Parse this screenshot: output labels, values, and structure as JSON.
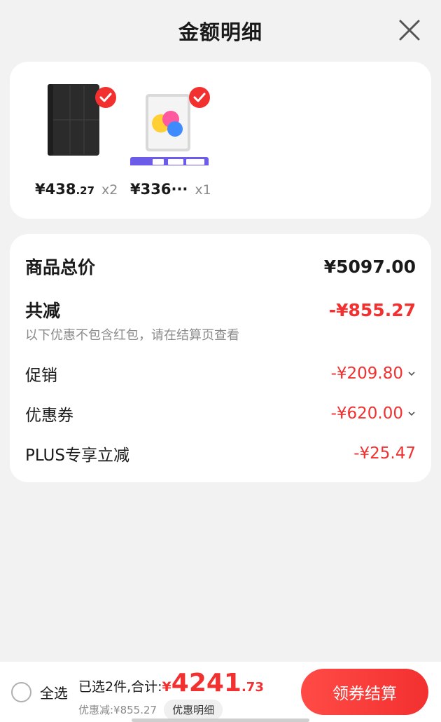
{
  "header": {
    "title": "金额明细",
    "close_icon": "close-icon"
  },
  "products": [
    {
      "price_yen": "¥",
      "price_int": "438",
      "price_dec": ".27",
      "qty": "x2",
      "image": "tablet-case-black",
      "checked": true
    },
    {
      "price_yen": "¥",
      "price_int": "336···",
      "price_dec": "",
      "qty": "x1",
      "image": "ipad-silver",
      "checked": true
    }
  ],
  "summary": {
    "total_label": "商品总价",
    "total_value": "¥5097.00",
    "reduced_label": "共减",
    "reduced_value": "-¥855.27",
    "note": "以下优惠不包含红包，请在结算页查看",
    "items": [
      {
        "label": "促销",
        "value": "-¥209.80",
        "expandable": true
      },
      {
        "label": "优惠券",
        "value": "-¥620.00",
        "expandable": true
      },
      {
        "label": "PLUS专享立减",
        "value": "-¥25.47",
        "expandable": false
      }
    ]
  },
  "footer": {
    "select_all": "全选",
    "selected_text": "已选2件,合计:",
    "total_yen": "¥",
    "total_int": "4241",
    "total_dec": ".73",
    "discount_text": "优惠减:¥855.27",
    "detail_button": "优惠明细",
    "checkout_button": "领券结算"
  },
  "colors": {
    "accent": "#f23030",
    "muted": "#8a8a8a",
    "background": "#f2f2f2"
  }
}
